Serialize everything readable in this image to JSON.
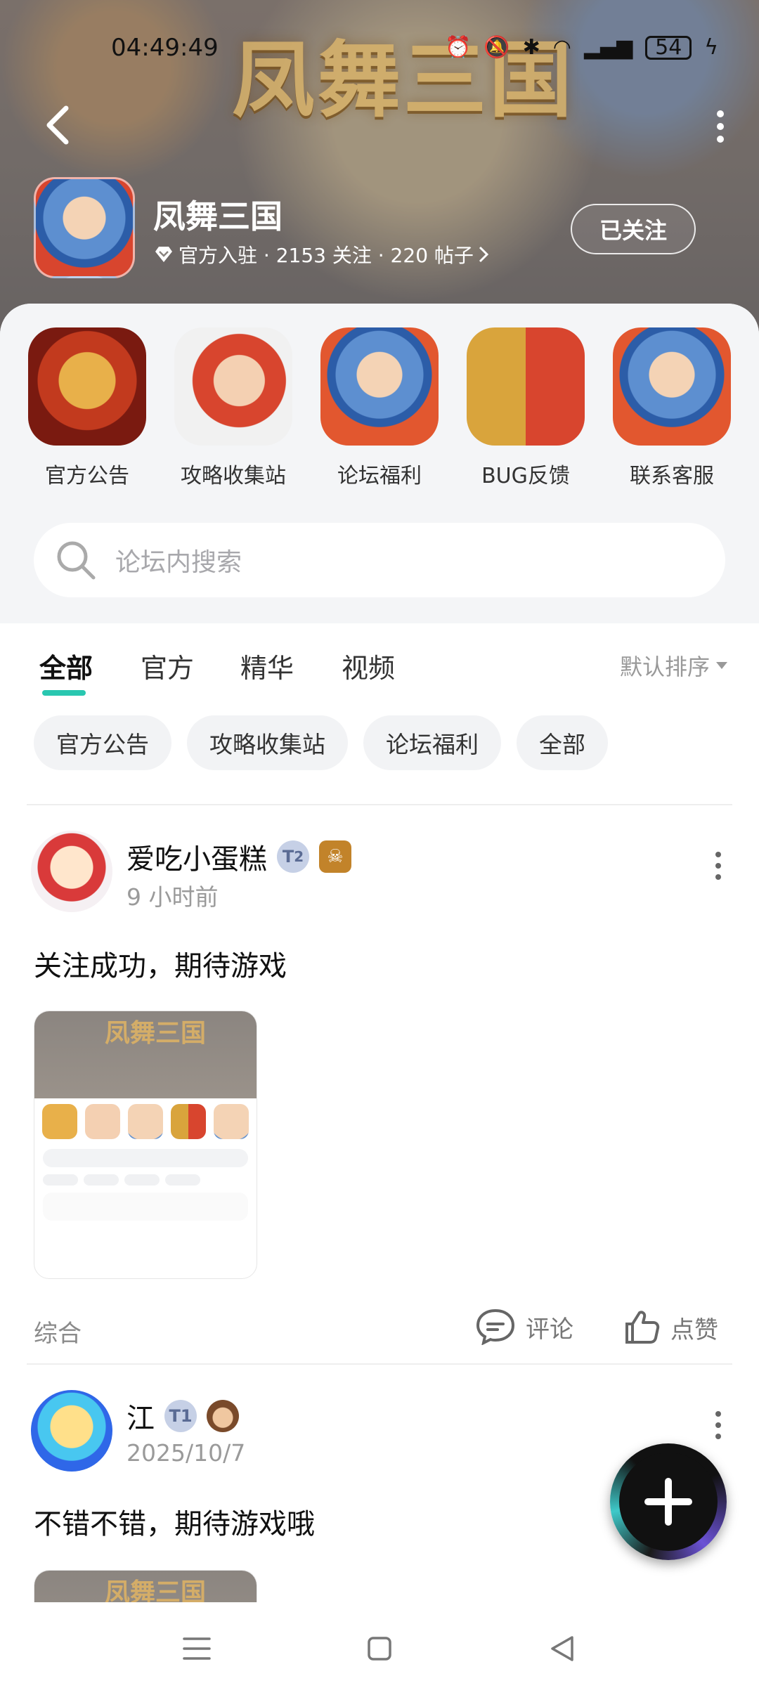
{
  "status_bar": {
    "time": "04:49:49",
    "battery": "54"
  },
  "header": {
    "banner_art_text": "凤舞三国",
    "game_name": "凤舞三国",
    "meta": "官方入驻 · 2153 关注 · 220 帖子",
    "follow_label": "已关注"
  },
  "quick_links": [
    {
      "label": "官方公告"
    },
    {
      "label": "攻略收集站"
    },
    {
      "label": "论坛福利"
    },
    {
      "label": "BUG反馈"
    },
    {
      "label": "联系客服"
    }
  ],
  "search": {
    "placeholder": "论坛内搜索"
  },
  "tabs": [
    {
      "label": "全部",
      "active": true
    },
    {
      "label": "官方"
    },
    {
      "label": "精华"
    },
    {
      "label": "视频"
    }
  ],
  "sort_label": "默认排序",
  "chips": [
    "官方公告",
    "攻略收集站",
    "论坛福利",
    "全部"
  ],
  "posts": [
    {
      "user": "爱吃小蛋糕",
      "badge_level": "2",
      "time": "9 小时前",
      "text": "关注成功，期待游戏",
      "category": "综合",
      "comment_label": "评论",
      "like_label": "点赞",
      "thumb_art": "凤舞三国"
    },
    {
      "user": "江",
      "time": "2025/10/7",
      "text": "不错不错，期待游戏哦",
      "thumb_art": "凤舞三国"
    }
  ],
  "colors": {
    "accent": "#29c7b0"
  }
}
